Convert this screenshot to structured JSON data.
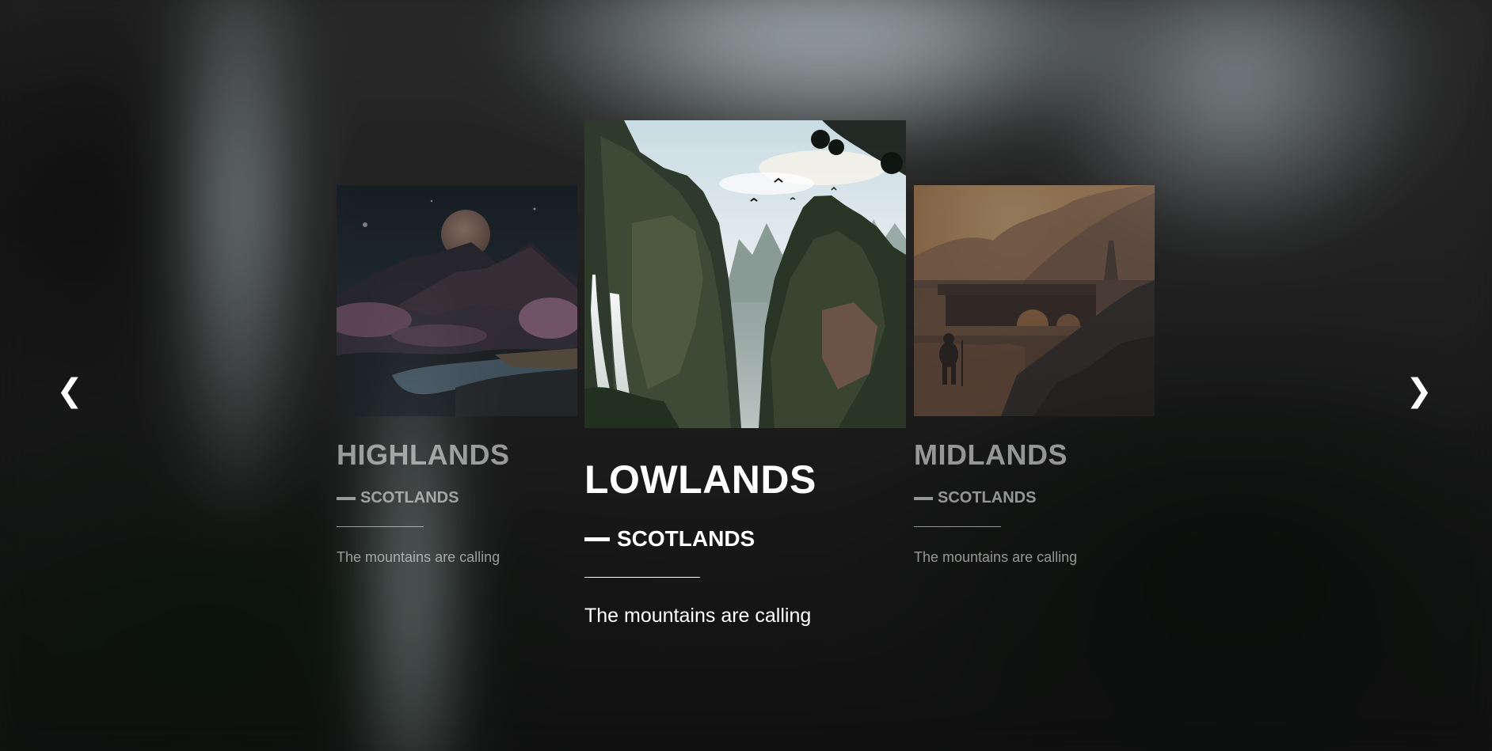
{
  "carousel": {
    "prev_icon": "❮",
    "next_icon": "❯",
    "slides": [
      {
        "image_label": "moonlit-mountains-river",
        "title": "HIGHLANDS",
        "subtitle": "SCOTLANDS",
        "text": "The mountains are calling"
      },
      {
        "image_label": "waterfall-canyon-cliffs",
        "title": "LOWLANDS",
        "subtitle": "SCOTLANDS",
        "text": "The mountains are calling"
      },
      {
        "image_label": "sunset-hiker-bridge",
        "title": "MIDLANDS",
        "subtitle": "SCOTLANDS",
        "text": "The mountains are calling"
      }
    ],
    "active_index": 1
  },
  "colors": {
    "text": "#ffffff",
    "backdrop_sky": "#cfdde0",
    "backdrop_dark": "#151515"
  }
}
